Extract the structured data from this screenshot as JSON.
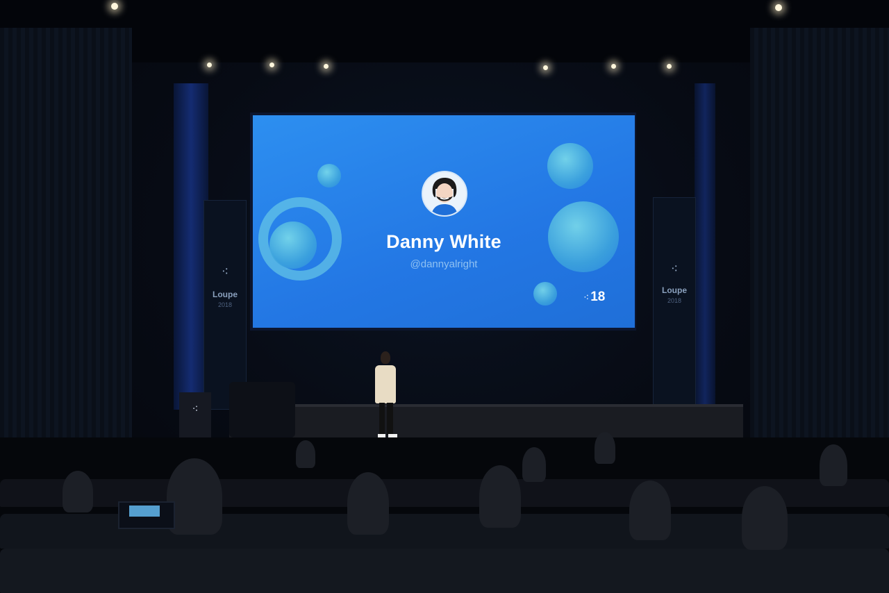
{
  "screen": {
    "speaker_name": "Danny White",
    "speaker_handle": "@dannyalright",
    "event_logo_mark": "⁖",
    "event_logo_year": "18"
  },
  "banners": {
    "left": {
      "logo_icon": "⁖",
      "name": "Loupe",
      "year": "2018"
    },
    "right": {
      "logo_icon": "⁖",
      "name": "Loupe",
      "year": "2018"
    }
  },
  "podium": {
    "logo_icon": "⁖"
  },
  "colors": {
    "slide_background": "#2a82ea",
    "slide_orbs": "#5cc8e0",
    "stage_dark": "#05070b"
  }
}
